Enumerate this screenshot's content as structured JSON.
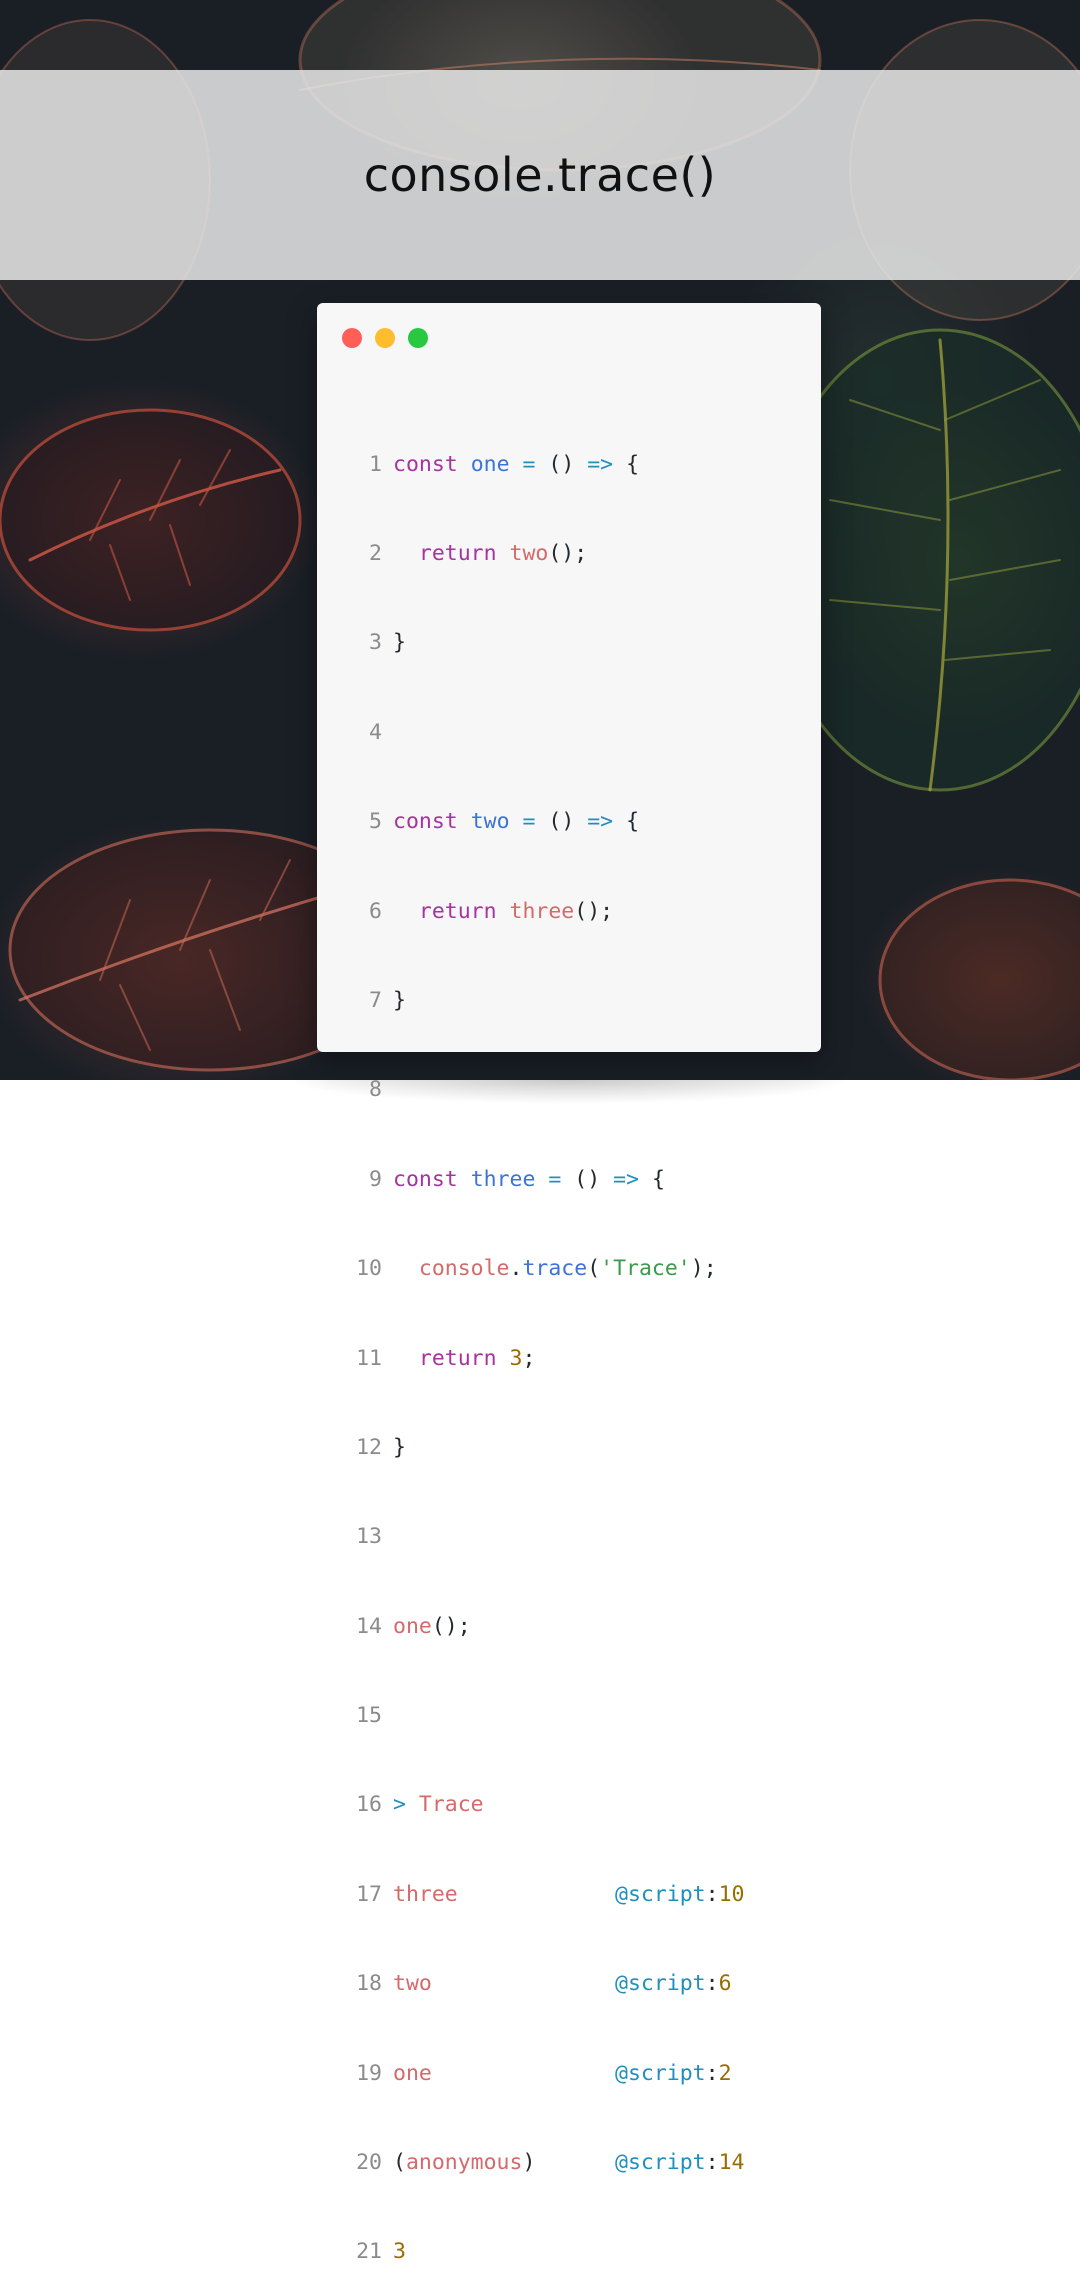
{
  "title": "console.trace()",
  "colors": {
    "keyword": "#a6339e",
    "function_name": "#3b73d9",
    "call": "#d46a6a",
    "operator": "#1f8fbf",
    "string": "#3b9a4a",
    "number": "#9a6c00",
    "dot_red": "#ff5f57",
    "dot_yellow": "#febc2e",
    "dot_green": "#28c840"
  },
  "code": {
    "line_numbers": [
      "1",
      "2",
      "3",
      "4",
      "5",
      "6",
      "7",
      "8",
      "9",
      "10",
      "11",
      "12",
      "13",
      "14",
      "15",
      "16",
      "17",
      "18",
      "19",
      "20",
      "21"
    ],
    "kw_const": "const",
    "kw_return": "return",
    "fn_one": "one",
    "fn_two": "two",
    "fn_three": "three",
    "assign": " = ",
    "parens": "()",
    "arrow": "=>",
    "open_brace": "{",
    "close_brace": "}",
    "console": "console",
    "trace_method": "trace",
    "trace_string": "'Trace'",
    "return_value": "3"
  },
  "output": {
    "prompt": ">",
    "heading": "Trace",
    "frames": [
      {
        "name": "three",
        "at": "@script",
        "line": "10"
      },
      {
        "name": "two",
        "at": "@script",
        "line": "6"
      },
      {
        "name": "one",
        "at": "@script",
        "line": "2"
      },
      {
        "name": "anonymous",
        "at": "@script",
        "line": "14"
      }
    ],
    "result": "3"
  }
}
